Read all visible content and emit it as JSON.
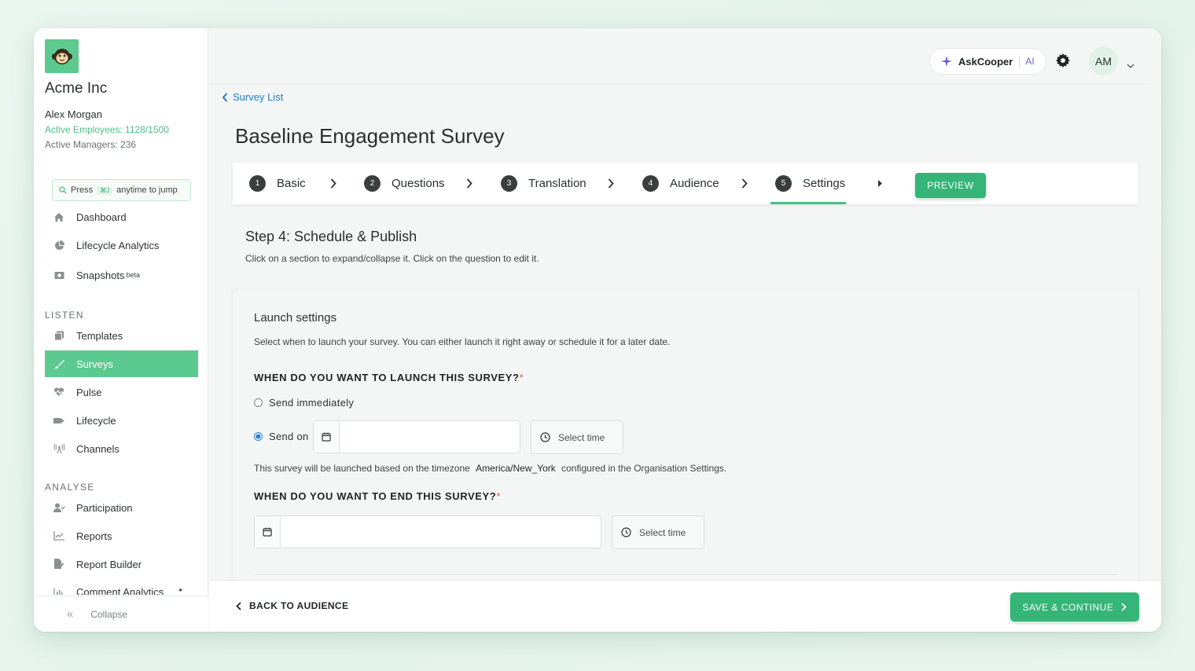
{
  "sidebar": {
    "company": "Acme Inc",
    "user_name": "Alex Morgan",
    "active_employees": "Active Employees: 1128/1500",
    "active_managers": "Active Managers: 236",
    "jump": {
      "press": "Press",
      "kbd": "⌘J",
      "suffix": "anytime to jump"
    },
    "top_items": [
      {
        "label": "Dashboard",
        "icon": "home-icon"
      },
      {
        "label": "Lifecycle Analytics",
        "icon": "pie-chart-icon"
      },
      {
        "label": "Snapshots",
        "icon": "camera-icon",
        "badge": "beta"
      }
    ],
    "listen_title": "LISTEN",
    "listen_items": [
      {
        "label": "Templates",
        "icon": "copy-icon"
      },
      {
        "label": "Surveys",
        "icon": "brush-icon",
        "active": true
      },
      {
        "label": "Pulse",
        "icon": "heartbeat-icon"
      },
      {
        "label": "Lifecycle",
        "icon": "flag-icon"
      },
      {
        "label": "Channels",
        "icon": "broadcast-icon"
      }
    ],
    "analyse_title": "ANALYSE",
    "analyse_items": [
      {
        "label": "Participation",
        "icon": "user-check-icon"
      },
      {
        "label": "Reports",
        "icon": "line-chart-icon"
      },
      {
        "label": "Report Builder",
        "icon": "file-edit-icon"
      },
      {
        "label": "Comment Analytics",
        "icon": "bar-chart-icon"
      }
    ],
    "collapse": "Collapse"
  },
  "header": {
    "askcooper": "AskCooper",
    "ai": "AI",
    "avatar_initials": "AM"
  },
  "breadcrumb": "Survey List",
  "page_title": "Baseline Engagement Survey",
  "steps": [
    {
      "num": "1",
      "label": "Basic"
    },
    {
      "num": "2",
      "label": "Questions"
    },
    {
      "num": "3",
      "label": "Translation"
    },
    {
      "num": "4",
      "label": "Audience"
    },
    {
      "num": "5",
      "label": "Settings",
      "active": true
    }
  ],
  "preview_label": "PREVIEW",
  "step_heading": "Step 4: Schedule & Publish",
  "step_desc": "Click on a section to expand/collapse it. Click on the question to edit it.",
  "launch": {
    "title": "Launch settings",
    "desc": "Select when to launch your survey. You can either launch it right away or schedule it for a later date.",
    "q_launch": "WHEN DO YOU WANT TO LAUNCH THIS SURVEY?",
    "opt_immediately": "Send immediately",
    "opt_send_on": "Send on",
    "selected": "Send on",
    "select_time": "Select time",
    "tz_prefix": "This survey will be launched based on the timezone",
    "timezone": "America/New_York",
    "tz_suffix": "configured in the Organisation Settings.",
    "q_end": "WHEN DO YOU WANT TO END THIS SURVEY?",
    "required_mark": "*",
    "start_date_value": "",
    "end_date_value": ""
  },
  "footer": {
    "back": "BACK TO AUDIENCE",
    "save": "SAVE & CONTINUE"
  },
  "colors": {
    "accent": "#35b577",
    "active_nav": "#5cc98f",
    "link": "#1d7fc4",
    "required": "#e25555"
  }
}
